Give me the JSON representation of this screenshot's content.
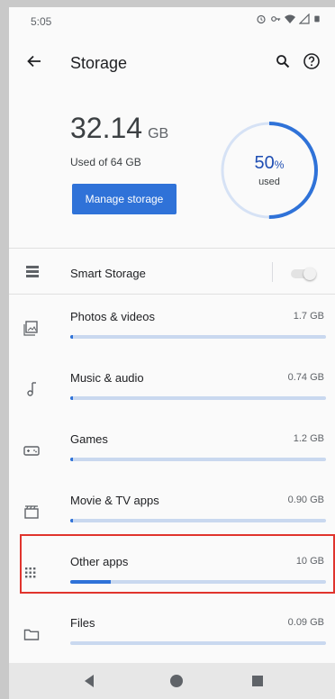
{
  "status": {
    "time": "5:05"
  },
  "appbar": {
    "title": "Storage"
  },
  "summary": {
    "used_amount": "32.14",
    "used_unit": "GB",
    "used_of": "Used of 64 GB",
    "manage_button": "Manage storage",
    "percent_value": "50",
    "percent_sign": "%",
    "percent_label": "used",
    "percent_fraction": 0.5
  },
  "smart_storage": {
    "label": "Smart Storage",
    "enabled": false
  },
  "categories": [
    {
      "label": "Photos & videos",
      "size": "1.7 GB",
      "icon": "photo-icon",
      "fill": 0.01
    },
    {
      "label": "Music & audio",
      "size": "0.74 GB",
      "icon": "music-note-icon",
      "fill": 0.01
    },
    {
      "label": "Games",
      "size": "1.2 GB",
      "icon": "gamepad-icon",
      "fill": 0.01
    },
    {
      "label": "Movie & TV apps",
      "size": "0.90 GB",
      "icon": "clapperboard-icon",
      "fill": 0.01
    },
    {
      "label": "Other apps",
      "size": "10 GB",
      "icon": "apps-grid-icon",
      "fill": 0.16
    },
    {
      "label": "Files",
      "size": "0.09 GB",
      "icon": "folder-icon",
      "fill": 0.0
    }
  ],
  "colors": {
    "accent": "#2f72d8",
    "highlight": "#e0342d",
    "bar_track": "#c9d8ef"
  },
  "navbar": {
    "icons": [
      "nav-back-icon",
      "nav-home-icon",
      "nav-recents-icon"
    ]
  }
}
